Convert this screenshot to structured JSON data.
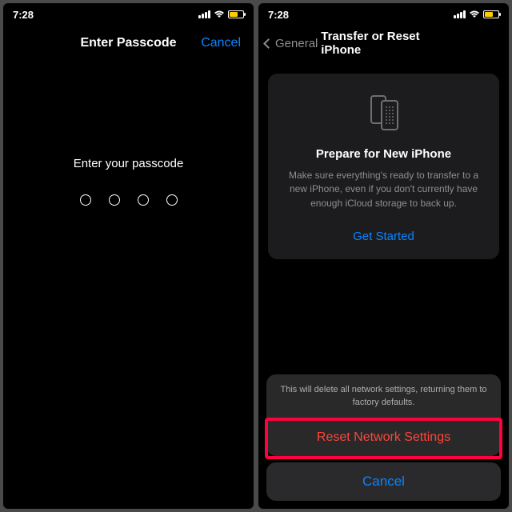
{
  "status": {
    "time": "7:28"
  },
  "left": {
    "nav_title": "Enter Passcode",
    "cancel": "Cancel",
    "prompt": "Enter your passcode"
  },
  "right": {
    "back_label": "General",
    "nav_title": "Transfer or Reset iPhone",
    "prepare": {
      "title": "Prepare for New iPhone",
      "desc": "Make sure everything's ready to transfer to a new iPhone, even if you don't currently have enough iCloud storage to back up.",
      "cta": "Get Started"
    },
    "sheet": {
      "label": "This will delete all network settings, returning them to factory defaults.",
      "destructive": "Reset Network Settings",
      "cancel": "Cancel"
    }
  }
}
